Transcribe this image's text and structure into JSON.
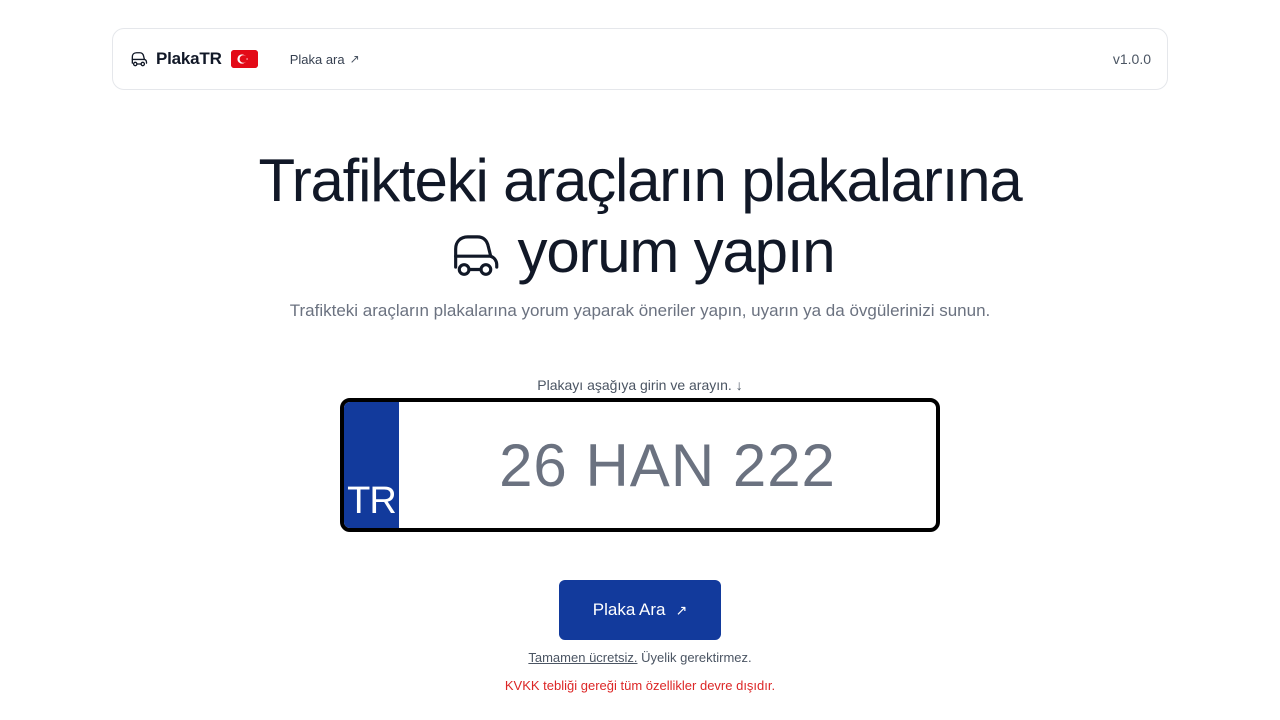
{
  "navbar": {
    "brand_name": "PlakaTR",
    "brand_icon": "car-icon",
    "flag_icon": "turkey-flag-icon",
    "search_link_label": "Plaka ara",
    "search_link_arrow": "↗",
    "version": "v1.0.0"
  },
  "hero": {
    "title_line1": "Trafikteki araçların plakalarına",
    "title_line2": "yorum yapın",
    "title_icon": "car-icon",
    "subtitle": "Trafikteki araçların plakalarına yorum yaparak öneriler yapın, uyarın ya da övgülerinizi sunun."
  },
  "search": {
    "hint": "Plakayı aşağıya girin ve arayın. ↓",
    "country_code": "TR",
    "plate_placeholder": "26 HAN 222",
    "plate_value": "",
    "button_label": "Plaka Ara",
    "button_arrow": "↗"
  },
  "notes": {
    "free_link": "Tamamen ücretsiz.",
    "free_rest": "Üyelik gerektirmez.",
    "kvkk": "KVKK tebliği gereği tüm özellikler devre dışıdır."
  },
  "colors": {
    "accent": "#123a9c",
    "flag_red": "#e30a17",
    "warning": "#dc2626"
  }
}
